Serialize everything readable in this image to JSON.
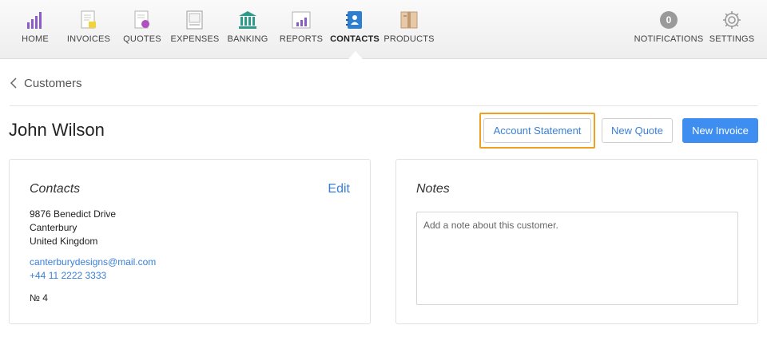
{
  "nav": {
    "items": [
      {
        "label": "HOME",
        "icon": "home-chart-icon"
      },
      {
        "label": "INVOICES",
        "icon": "invoice-icon"
      },
      {
        "label": "QUOTES",
        "icon": "quote-icon"
      },
      {
        "label": "EXPENSES",
        "icon": "expenses-icon"
      },
      {
        "label": "BANKING",
        "icon": "bank-icon"
      },
      {
        "label": "REPORTS",
        "icon": "reports-icon"
      },
      {
        "label": "CONTACTS",
        "icon": "contacts-icon",
        "active": true
      },
      {
        "label": "PRODUCTS",
        "icon": "products-icon"
      }
    ],
    "notifications": {
      "count": "0",
      "label": "NOTIFICATIONS"
    },
    "settings": {
      "label": "SETTINGS",
      "icon": "gear-icon"
    }
  },
  "breadcrumb": {
    "label": "Customers"
  },
  "page": {
    "title": "John Wilson"
  },
  "actions": {
    "account_statement": "Account Statement",
    "new_quote": "New Quote",
    "new_invoice": "New Invoice"
  },
  "contacts_card": {
    "title": "Contacts",
    "edit_label": "Edit",
    "address_line1": "9876 Benedict Drive",
    "address_line2": "Canterbury",
    "address_line3": "United Kingdom",
    "email": "canterburydesigns@mail.com",
    "phone": "+44 11 2222 3333",
    "number": "№ 4"
  },
  "notes_card": {
    "title": "Notes",
    "placeholder": "Add a note about this customer."
  },
  "colors": {
    "accent": "#3d8ef0",
    "link": "#3a7fd9",
    "highlight": "#f0a020"
  }
}
